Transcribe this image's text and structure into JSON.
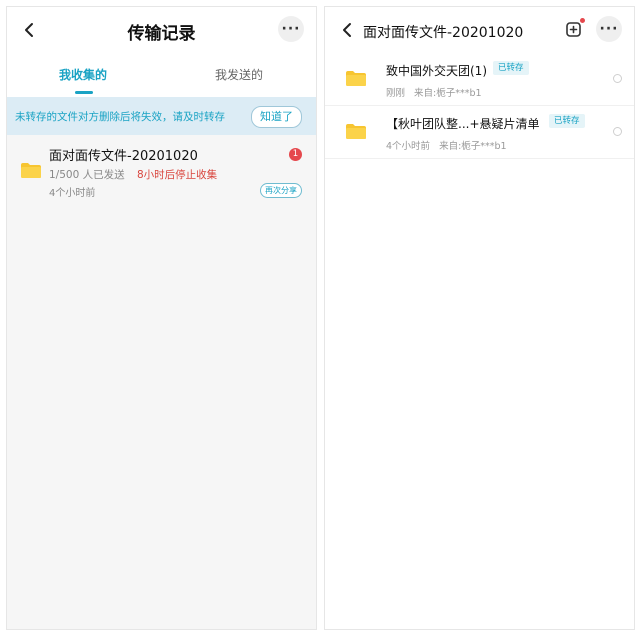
{
  "left": {
    "header": {
      "title": "传输记录",
      "more_label": "···"
    },
    "tabs": [
      {
        "label": "我收集的",
        "active": true
      },
      {
        "label": "我发送的",
        "active": false
      }
    ],
    "notice": {
      "text": "未转存的文件对方删除后将失效，请及时转存",
      "button_label": "知道了"
    },
    "record": {
      "name": "面对面传文件-20201020",
      "sent_count": "1/500 人已发送",
      "deadline": "8小时后停止收集",
      "time": "4个小时前",
      "badge": "1",
      "reshare_label": "再次分享"
    }
  },
  "right": {
    "header": {
      "title": "面对面传文件-20201020",
      "more_label": "···"
    },
    "files": [
      {
        "name": "致中国外交天团(1)",
        "tag": "已转存",
        "time": "刚刚",
        "source": "来自:栀子***b1"
      },
      {
        "name": "【秋叶团队整...+悬疑片清单",
        "tag": "已转存",
        "time": "4个小时前",
        "source": "来自:栀子***b1"
      }
    ]
  },
  "colors": {
    "accent": "#1aa3c4",
    "alert": "#d9463e",
    "folder": "#f7c531",
    "notice_bg": "#dcecf5"
  }
}
